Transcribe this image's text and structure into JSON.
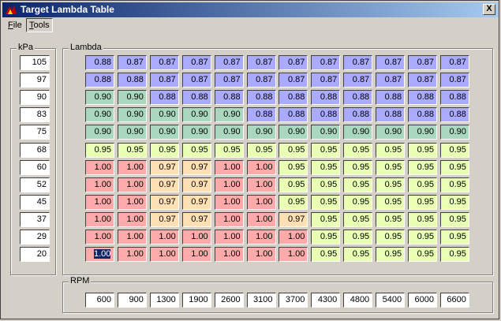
{
  "window": {
    "title": "Target Lambda Table",
    "close_glyph": "X"
  },
  "menu": [
    {
      "accel": "F",
      "rest": "ile"
    },
    {
      "accel": "T",
      "rest": "ools"
    }
  ],
  "kpa": {
    "label": "kPa",
    "values": [
      "105",
      "97",
      "90",
      "83",
      "75",
      "68",
      "60",
      "52",
      "45",
      "37",
      "29",
      "20"
    ]
  },
  "lambda": {
    "label": "Lambda",
    "rows": [
      [
        "0.88",
        "0.87",
        "0.87",
        "0.87",
        "0.87",
        "0.87",
        "0.87",
        "0.87",
        "0.87",
        "0.87",
        "0.87",
        "0.87"
      ],
      [
        "0.88",
        "0.88",
        "0.87",
        "0.87",
        "0.87",
        "0.87",
        "0.87",
        "0.87",
        "0.87",
        "0.87",
        "0.87",
        "0.87"
      ],
      [
        "0.90",
        "0.90",
        "0.88",
        "0.88",
        "0.88",
        "0.88",
        "0.88",
        "0.88",
        "0.88",
        "0.88",
        "0.88",
        "0.88"
      ],
      [
        "0.90",
        "0.90",
        "0.90",
        "0.90",
        "0.90",
        "0.88",
        "0.88",
        "0.88",
        "0.88",
        "0.88",
        "0.88",
        "0.88"
      ],
      [
        "0.90",
        "0.90",
        "0.90",
        "0.90",
        "0.90",
        "0.90",
        "0.90",
        "0.90",
        "0.90",
        "0.90",
        "0.90",
        "0.90"
      ],
      [
        "0.95",
        "0.95",
        "0.95",
        "0.95",
        "0.95",
        "0.95",
        "0.95",
        "0.95",
        "0.95",
        "0.95",
        "0.95",
        "0.95"
      ],
      [
        "1.00",
        "1.00",
        "0.97",
        "0.97",
        "1.00",
        "1.00",
        "0.95",
        "0.95",
        "0.95",
        "0.95",
        "0.95",
        "0.95"
      ],
      [
        "1.00",
        "1.00",
        "0.97",
        "0.97",
        "1.00",
        "1.00",
        "0.95",
        "0.95",
        "0.95",
        "0.95",
        "0.95",
        "0.95"
      ],
      [
        "1.00",
        "1.00",
        "0.97",
        "0.97",
        "1.00",
        "1.00",
        "0.95",
        "0.95",
        "0.95",
        "0.95",
        "0.95",
        "0.95"
      ],
      [
        "1.00",
        "1.00",
        "0.97",
        "0.97",
        "1.00",
        "1.00",
        "0.97",
        "0.95",
        "0.95",
        "0.95",
        "0.95",
        "0.95"
      ],
      [
        "1.00",
        "1.00",
        "1.00",
        "1.00",
        "1.00",
        "1.00",
        "1.00",
        "0.95",
        "0.95",
        "0.95",
        "0.95",
        "0.95"
      ],
      [
        "1.00",
        "1.00",
        "1.00",
        "1.00",
        "1.00",
        "1.00",
        "1.00",
        "0.95",
        "0.95",
        "0.95",
        "0.95",
        "0.95"
      ]
    ],
    "selected_cell": [
      11,
      0
    ],
    "colors": {
      "0.87": "#aaaaff",
      "0.88": "#aaaaff",
      "0.90": "#aad8be",
      "0.95": "#e8ffb4",
      "0.97": "#ffe0b4",
      "1.00": "#ffaaaa"
    }
  },
  "rpm": {
    "label": "RPM",
    "values": [
      "600",
      "900",
      "1300",
      "1900",
      "2600",
      "3100",
      "3700",
      "4300",
      "4800",
      "5400",
      "6000",
      "6600"
    ]
  }
}
